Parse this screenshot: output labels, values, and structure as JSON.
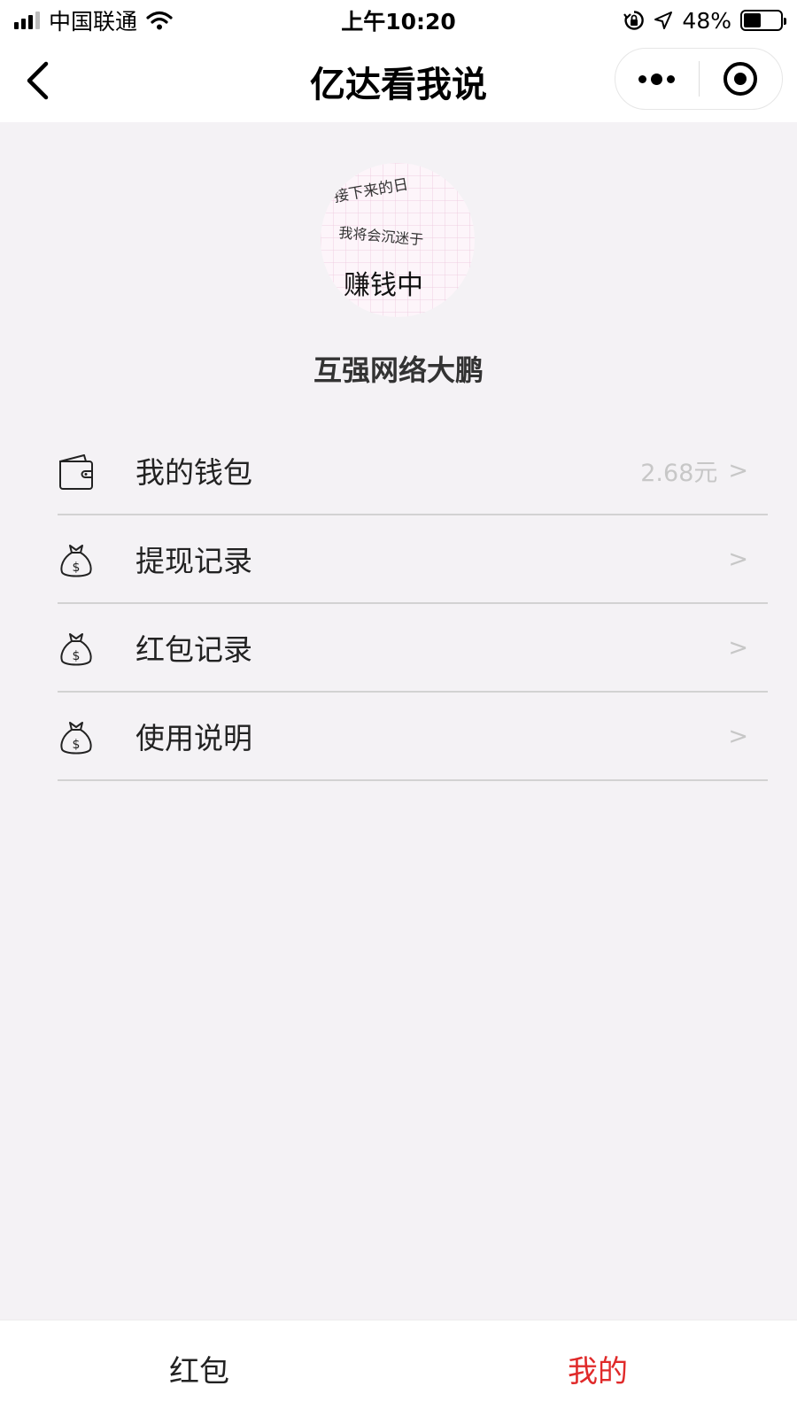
{
  "status_bar": {
    "carrier": "中国联通",
    "time": "上午10:20",
    "battery": "48%",
    "battery_level": 0.48
  },
  "nav": {
    "title": "亿达看我说"
  },
  "profile": {
    "avatar_lines": [
      "接下来的日",
      "我将会沉迷于",
      "赚钱中"
    ],
    "name": "互强网络大鹏"
  },
  "menu": [
    {
      "label": "我的钱包",
      "value": "2.68元",
      "arrow": ">",
      "icon": "wallet-icon"
    },
    {
      "label": "提现记录",
      "value": "",
      "arrow": ">",
      "icon": "money-bag-icon"
    },
    {
      "label": "红包记录",
      "value": "",
      "arrow": ">",
      "icon": "money-bag-icon"
    },
    {
      "label": "使用说明",
      "value": "",
      "arrow": ">",
      "icon": "money-bag-icon"
    }
  ],
  "tab_bar": {
    "tabs": [
      {
        "label": "红包",
        "active": false
      },
      {
        "label": "我的",
        "active": true
      }
    ]
  },
  "colors": {
    "active_tab": "#e02a2a",
    "background": "#f4f2f5"
  }
}
